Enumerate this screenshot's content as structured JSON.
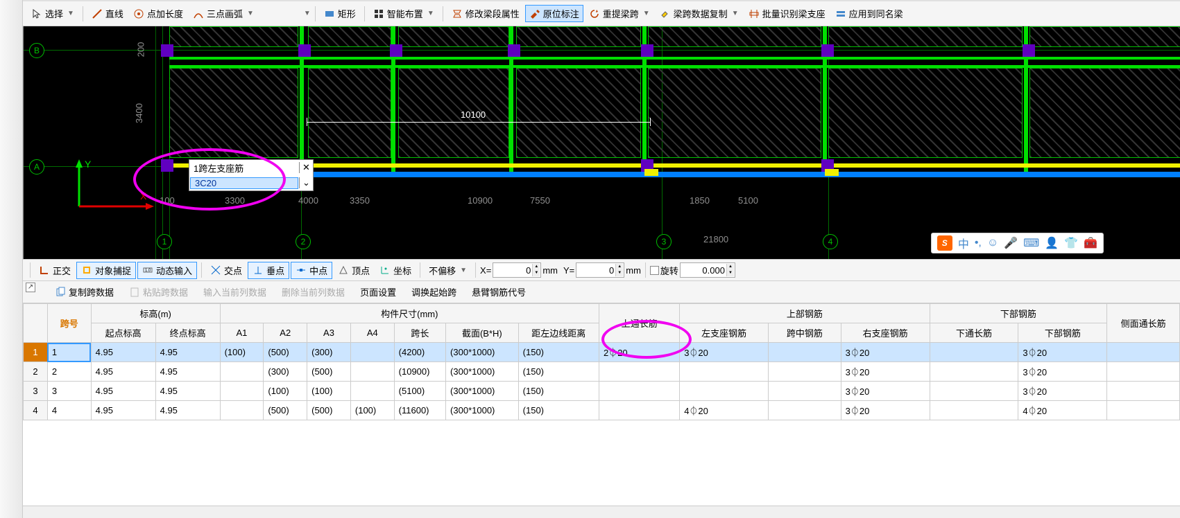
{
  "toolbar1": {
    "select": "选择",
    "line": "直线",
    "point_length": "点加长度",
    "three_point_arc": "三点画弧",
    "rect": "矩形",
    "smart_layout": "智能布置",
    "modify_beam_attr": "修改梁段属性",
    "in_place_label": "原位标注",
    "re_span": "重提梁跨",
    "copy_span_data": "梁跨数据复制",
    "batch_recognize": "批量识别梁支座",
    "apply_same_beam": "应用到同名梁"
  },
  "canvas": {
    "grid_labels_h": [
      "B",
      "A"
    ],
    "grid_labels_v": [
      "1",
      "2",
      "3",
      "4"
    ],
    "dim_v": [
      "200",
      "3400"
    ],
    "dim_top": "10100",
    "dim_bottom": [
      "100",
      "3300",
      "4000",
      "3350",
      "10900",
      "7550",
      "1850",
      "5100"
    ],
    "dim_far": "21800",
    "popup_label": "1跨左支座筋",
    "popup_value": "3C20",
    "axis_x": "X",
    "axis_y": "Y"
  },
  "toolbar2": {
    "ortho": "正交",
    "object_snap": "对象捕捉",
    "dynamic_input": "动态输入",
    "intersect": "交点",
    "perp": "垂点",
    "mid": "中点",
    "vertex": "顶点",
    "coord": "坐标",
    "offset_mode": "不偏移",
    "x_label": "X=",
    "x_val": "0",
    "y_label": "Y=",
    "y_val": "0",
    "unit": "mm",
    "rotate": "旋转",
    "rotate_val": "0.000"
  },
  "toolbar3": {
    "copy_span": "复制跨数据",
    "paste_span": "粘贴跨数据",
    "input_col": "输入当前列数据",
    "delete_col": "删除当前列数据",
    "page_setup": "页面设置",
    "swap_start": "调换起始跨",
    "cantilever": "悬臂钢筋代号"
  },
  "table": {
    "group_headers": {
      "span_no": "跨号",
      "elevation": "标高(m)",
      "dimensions": "构件尺寸(mm)",
      "top_long": "上通长筋",
      "top_rebar": "上部钢筋",
      "bottom_rebar": "下部钢筋",
      "side": "侧面通长筋"
    },
    "headers": {
      "start_elev": "起点标高",
      "end_elev": "终点标高",
      "a1": "A1",
      "a2": "A2",
      "a3": "A3",
      "a4": "A4",
      "span_len": "跨长",
      "section": "截面(B*H)",
      "edge_dist": "距左边线距离",
      "left_support": "左支座钢筋",
      "mid_span": "跨中钢筋",
      "right_support": "右支座钢筋",
      "bottom_long": "下通长筋",
      "bottom_steel": "下部钢筋"
    },
    "rows": [
      {
        "n": "1",
        "span": "1",
        "se": "4.95",
        "ee": "4.95",
        "a1": "(100)",
        "a2": "(500)",
        "a3": "(300)",
        "a4": "",
        "len": "(4200)",
        "sec": "(300*1000)",
        "ed": "(150)",
        "tl": "2⏀20",
        "ls": "3⏀20",
        "mid": "",
        "rs": "3⏀20",
        "bl": "",
        "bs": "3⏀20"
      },
      {
        "n": "2",
        "span": "2",
        "se": "4.95",
        "ee": "4.95",
        "a1": "",
        "a2": "(300)",
        "a3": "(500)",
        "a4": "",
        "len": "(10900)",
        "sec": "(300*1000)",
        "ed": "(150)",
        "tl": "",
        "ls": "",
        "mid": "",
        "rs": "3⏀20",
        "bl": "",
        "bs": "3⏀20"
      },
      {
        "n": "3",
        "span": "3",
        "se": "4.95",
        "ee": "4.95",
        "a1": "",
        "a2": "(100)",
        "a3": "(100)",
        "a4": "",
        "len": "(5100)",
        "sec": "(300*1000)",
        "ed": "(150)",
        "tl": "",
        "ls": "",
        "mid": "",
        "rs": "3⏀20",
        "bl": "",
        "bs": "3⏀20"
      },
      {
        "n": "4",
        "span": "4",
        "se": "4.95",
        "ee": "4.95",
        "a1": "",
        "a2": "(500)",
        "a3": "(500)",
        "a4": "(100)",
        "len": "(11600)",
        "sec": "(300*1000)",
        "ed": "(150)",
        "tl": "",
        "ls": "4⏀20",
        "mid": "",
        "rs": "3⏀20",
        "bl": "",
        "bs": "4⏀20"
      }
    ]
  },
  "ime": {
    "lang": "中"
  }
}
